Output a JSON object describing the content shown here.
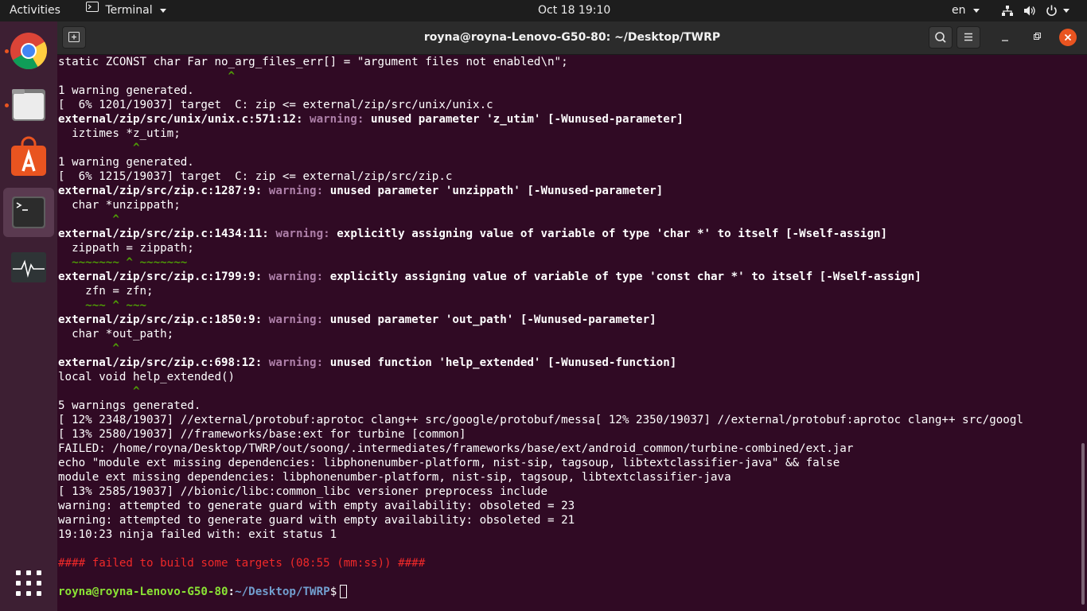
{
  "topbar": {
    "activities": "Activities",
    "app_menu": "Terminal",
    "clock": "Oct 18  19:10",
    "language": "en"
  },
  "dock": {
    "apps": [
      "google-chrome-icon",
      "files-icon",
      "software-store-icon",
      "terminal-icon",
      "system-monitor-icon"
    ],
    "show_apps": "show-applications-icon"
  },
  "window": {
    "title": "royna@royna-Lenovo-G50-80: ~/Desktop/TWRP"
  },
  "terminal": {
    "l00": "static ZCONST char Far no_arg_files_err[] = \"argument files not enabled\\n\";",
    "l01": "                         ^",
    "l02": "1 warning generated.",
    "l03": "[  6% 1201/19037] target  C: zip <= external/zip/src/unix/unix.c",
    "l04_loc": "external/zip/src/unix/unix.c:571:12:",
    "l04_w": "warning:",
    "l04_msg": "unused parameter 'z_utim' [-Wunused-parameter]",
    "l05": "  iztimes *z_utim;",
    "l06": "           ^",
    "l07": "1 warning generated.",
    "l08": "[  6% 1215/19037] target  C: zip <= external/zip/src/zip.c",
    "l09_loc": "external/zip/src/zip.c:1287:9:",
    "l09_w": "warning:",
    "l09_msg": "unused parameter 'unzippath' [-Wunused-parameter]",
    "l10": "  char *unzippath;",
    "l11": "        ^",
    "l12_loc": "external/zip/src/zip.c:1434:11:",
    "l12_w": "warning:",
    "l12_msg": "explicitly assigning value of variable of type 'char *' to itself [-Wself-assign]",
    "l13": "  zippath = zippath;",
    "l14": "  ~~~~~~~ ^ ~~~~~~~",
    "l15_loc": "external/zip/src/zip.c:1799:9:",
    "l15_w": "warning:",
    "l15_msg": "explicitly assigning value of variable of type 'const char *' to itself [-Wself-assign]",
    "l16": "    zfn = zfn;",
    "l17": "    ~~~ ^ ~~~",
    "l18_loc": "external/zip/src/zip.c:1850:9:",
    "l18_w": "warning:",
    "l18_msg": "unused parameter 'out_path' [-Wunused-parameter]",
    "l19": "  char *out_path;",
    "l20": "        ^",
    "l21_loc": "external/zip/src/zip.c:698:12:",
    "l21_w": "warning:",
    "l21_msg": "unused function 'help_extended' [-Wunused-function]",
    "l22": "local void help_extended()",
    "l23": "           ^",
    "l24": "5 warnings generated.",
    "l25": "[ 12% 2348/19037] //external/protobuf:aprotoc clang++ src/google/protobuf/messa[ 12% 2350/19037] //external/protobuf:aprotoc clang++ src/googl",
    "l26": "[ 13% 2580/19037] //frameworks/base:ext for turbine [common]",
    "l27": "FAILED: /home/royna/Desktop/TWRP/out/soong/.intermediates/frameworks/base/ext/android_common/turbine-combined/ext.jar",
    "l28": "echo \"module ext missing dependencies: libphonenumber-platform, nist-sip, tagsoup, libtextclassifier-java\" && false",
    "l29": "module ext missing dependencies: libphonenumber-platform, nist-sip, tagsoup, libtextclassifier-java",
    "l30": "[ 13% 2585/19037] //bionic/libc:common_libc versioner preprocess include",
    "l31": "warning: attempted to generate guard with empty availability: obsoleted = 23",
    "l32": "warning: attempted to generate guard with empty availability: obsoleted = 21",
    "l33": "19:10:23 ninja failed with: exit status 1",
    "l34": "",
    "l35": "#### failed to build some targets (08:55 (mm:ss)) ####",
    "l36": "",
    "prompt_user": "royna@royna-Lenovo-G50-80",
    "prompt_colon": ":",
    "prompt_path": "~/Desktop/TWRP",
    "prompt_sym": "$"
  },
  "colors": {
    "terminal_bg": "#300a24",
    "warning": "#ad7fa8",
    "caret_green": "#4e9a06",
    "error_red": "#ef2929",
    "prompt_green": "#8ae234",
    "prompt_blue": "#729fcf",
    "ubuntu_orange": "#e95420"
  }
}
